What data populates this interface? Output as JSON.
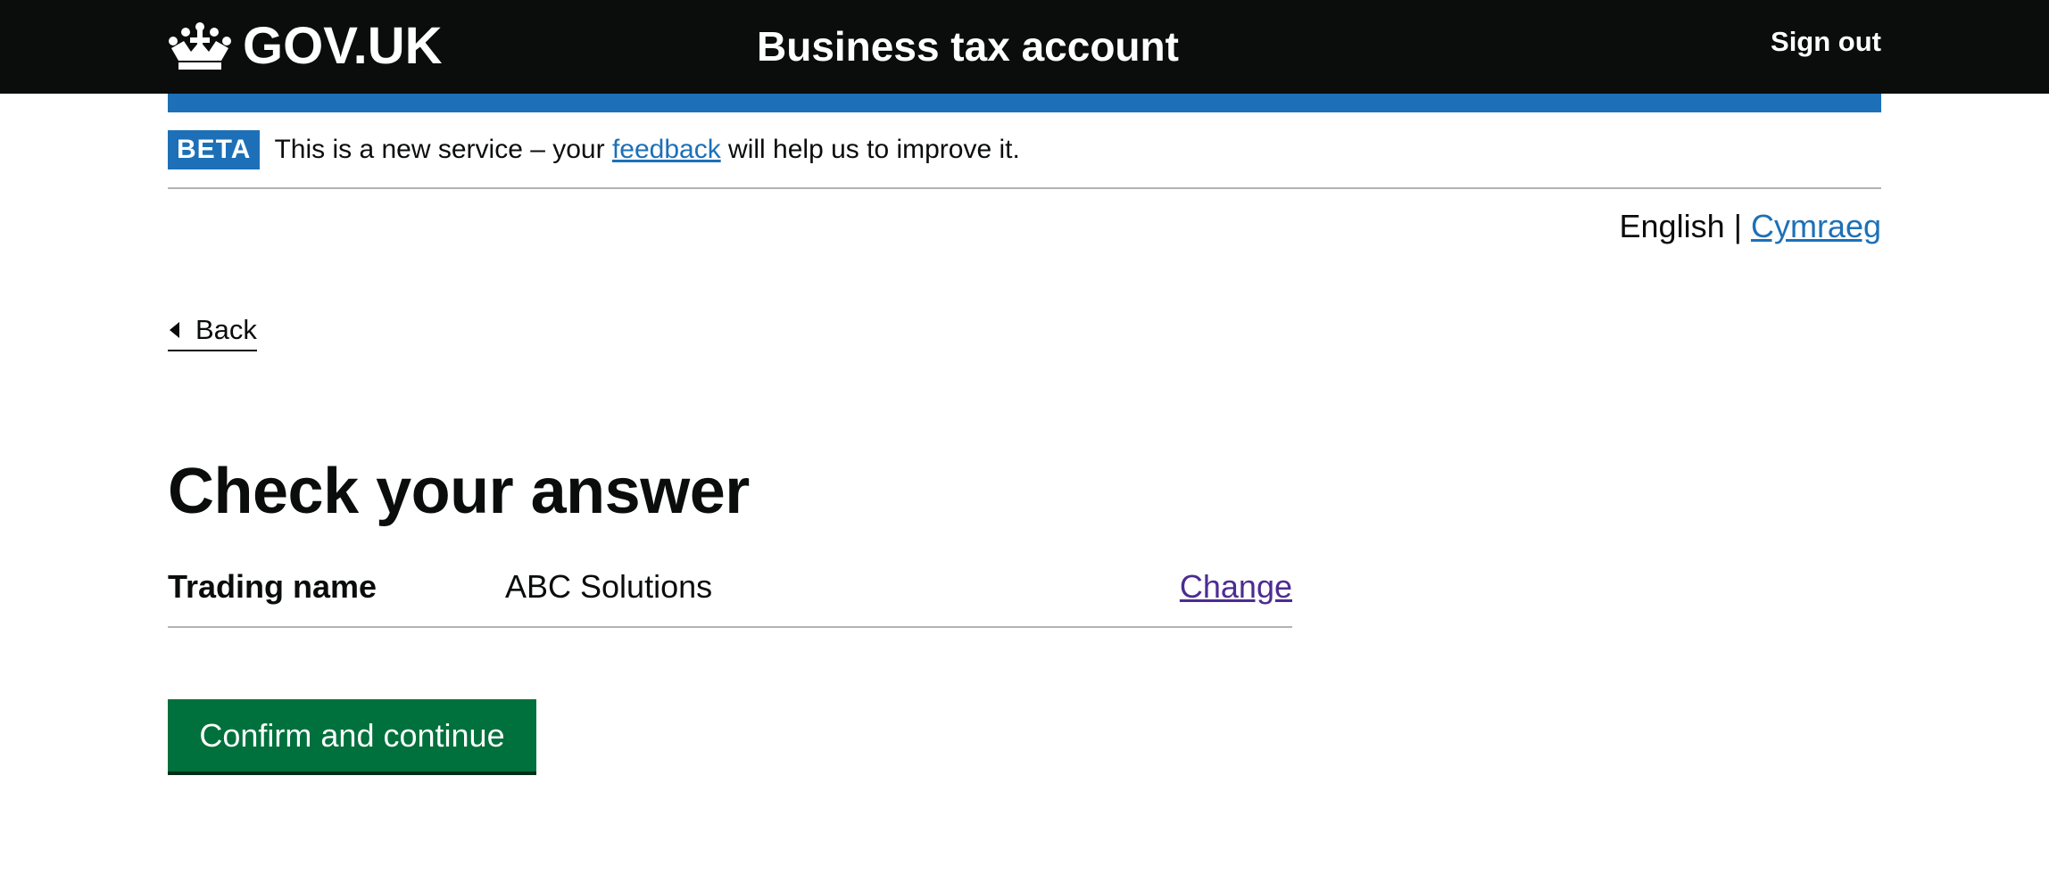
{
  "header": {
    "logo_text": "GOV.UK",
    "service_name": "Business tax account",
    "sign_out": "Sign out"
  },
  "phase_banner": {
    "tag": "BETA",
    "text_before": "This is a new service – your ",
    "link": "feedback",
    "text_after": " will help us to improve it."
  },
  "language": {
    "current": "English",
    "separator": " | ",
    "alternate": "Cymraeg"
  },
  "back_link": "Back",
  "page_title": "Check your answer",
  "summary": {
    "key": "Trading name",
    "value": "ABC Solutions",
    "action": "Change"
  },
  "confirm_button": "Confirm and continue",
  "colors": {
    "header_bg": "#0b0c0c",
    "brand_blue": "#1d70b8",
    "button_green": "#00703c",
    "visited_link": "#4c2c92"
  }
}
